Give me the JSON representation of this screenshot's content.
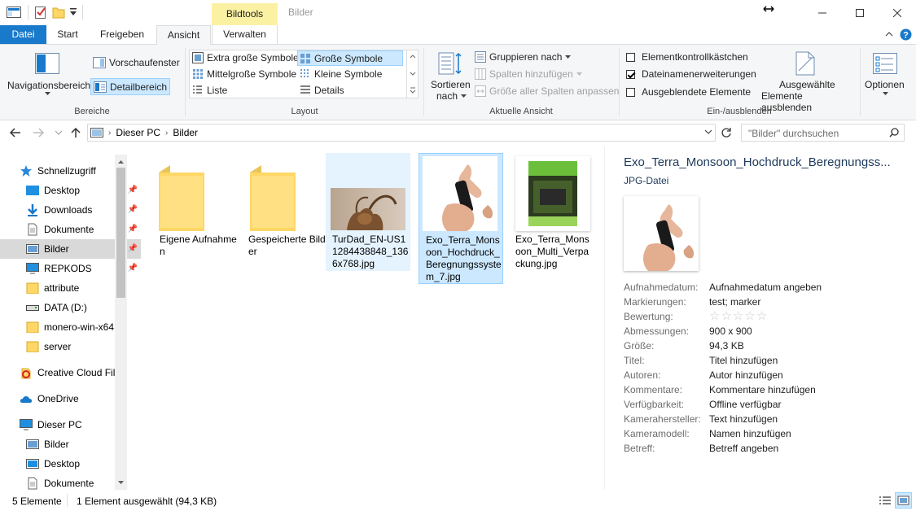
{
  "window": {
    "title": "Bilder",
    "context_tab": "Bildtools"
  },
  "ribbon_tabs": [
    "Datei",
    "Start",
    "Freigeben",
    "Ansicht",
    "Verwalten"
  ],
  "ribbon": {
    "panes": {
      "group_label": "Bereiche",
      "navigation_pane": "Navigationsbereich",
      "preview_pane": "Vorschaufenster",
      "details_pane": "Detailbereich"
    },
    "layout": {
      "group_label": "Layout",
      "options": [
        "Extra große Symbole",
        "Große Symbole",
        "Mittelgroße Symbole",
        "Kleine Symbole",
        "Liste",
        "Details"
      ],
      "selected": "Große Symbole"
    },
    "current_view": {
      "group_label": "Aktuelle Ansicht",
      "sort_by_line1": "Sortieren",
      "sort_by_line2": "nach",
      "group_by": "Gruppieren nach",
      "add_columns": "Spalten hinzufügen",
      "size_columns": "Größe aller Spalten anpassen"
    },
    "show_hide": {
      "group_label": "Ein-/ausblenden",
      "item_checkboxes": "Elementkontrollkästchen",
      "item_checkboxes_checked": false,
      "file_extensions": "Dateinamenerweiterungen",
      "file_extensions_checked": true,
      "hidden_items": "Ausgeblendete Elemente",
      "hidden_items_checked": false,
      "hide_selected_line1": "Ausgewählte",
      "hide_selected_line2": "Elemente ausblenden"
    },
    "options": "Optionen"
  },
  "address": {
    "path": [
      "Dieser PC",
      "Bilder"
    ],
    "search_placeholder": "\"Bilder\" durchsuchen"
  },
  "nav": {
    "items": [
      {
        "label": "Schnellzugriff",
        "icon": "star-icon",
        "pinned": false,
        "level": 0
      },
      {
        "label": "Desktop",
        "icon": "desktop-icon",
        "pinned": true,
        "level": 1
      },
      {
        "label": "Downloads",
        "icon": "download-icon",
        "pinned": true,
        "level": 1
      },
      {
        "label": "Dokumente",
        "icon": "document-icon",
        "pinned": true,
        "level": 1
      },
      {
        "label": "Bilder",
        "icon": "pictures-icon",
        "pinned": true,
        "level": 1,
        "selected": true
      },
      {
        "label": "REPKODS",
        "icon": "monitor-icon",
        "pinned": true,
        "level": 1
      },
      {
        "label": "attribute",
        "icon": "folder-icon",
        "pinned": false,
        "level": 1
      },
      {
        "label": "DATA (D:)",
        "icon": "drive-icon",
        "pinned": false,
        "level": 1
      },
      {
        "label": "monero-win-x64",
        "icon": "folder-icon",
        "pinned": false,
        "level": 1
      },
      {
        "label": "server",
        "icon": "folder-icon",
        "pinned": false,
        "level": 1
      },
      {
        "label": "Creative Cloud Fil",
        "icon": "creative-cloud-icon",
        "pinned": false,
        "level": 0
      },
      {
        "label": "OneDrive",
        "icon": "onedrive-icon",
        "pinned": false,
        "level": 0
      },
      {
        "label": "Dieser PC",
        "icon": "pc-icon",
        "pinned": false,
        "level": 0
      },
      {
        "label": "Bilder",
        "icon": "pictures-icon",
        "pinned": false,
        "level": 1
      },
      {
        "label": "Desktop",
        "icon": "desktop-icon",
        "pinned": false,
        "level": 1
      },
      {
        "label": "Dokumente",
        "icon": "document-icon",
        "pinned": false,
        "level": 1
      }
    ]
  },
  "files": [
    {
      "name": "Eigene Aufnahmen",
      "type": "folder",
      "state": "none"
    },
    {
      "name": "Gespeicherte Bilder",
      "type": "folder",
      "state": "none"
    },
    {
      "name": "TurDad_EN-US11284438848_1366x768.jpg",
      "type": "ibex-image",
      "state": "hover"
    },
    {
      "name": "Exo_Terra_Monsoon_Hochdruck_Beregnungssystem_7.jpg",
      "type": "nozzle-image",
      "state": "selected"
    },
    {
      "name": "Exo_Terra_Monsoon_Multi_Verpackung.jpg",
      "type": "box-image",
      "state": "none"
    }
  ],
  "details": {
    "title": "Exo_Terra_Monsoon_Hochdruck_Beregnungss...",
    "file_type": "JPG-Datei",
    "rating_stars": 0,
    "props": [
      {
        "key": "Aufnahmedatum:",
        "value": "Aufnahmedatum angeben"
      },
      {
        "key": "Markierungen:",
        "value": "test; marker"
      },
      {
        "key": "Bewertung:",
        "value": ""
      },
      {
        "key": "Abmessungen:",
        "value": "900 x 900"
      },
      {
        "key": "Größe:",
        "value": "94,3 KB"
      },
      {
        "key": "Titel:",
        "value": "Titel hinzufügen"
      },
      {
        "key": "Autoren:",
        "value": "Autor hinzufügen"
      },
      {
        "key": "Kommentare:",
        "value": "Kommentare hinzufügen"
      },
      {
        "key": "Verfügbarkeit:",
        "value": "Offline verfügbar"
      },
      {
        "key": "Kamerahersteller:",
        "value": "Text hinzufügen"
      },
      {
        "key": "Kameramodell:",
        "value": "Namen hinzufügen"
      },
      {
        "key": "Betreff:",
        "value": "Betreff angeben"
      }
    ]
  },
  "status": {
    "count": "5 Elemente",
    "selection": "1 Element ausgewählt (94,3 KB)"
  },
  "colors": {
    "accent": "#1979ca",
    "selected_bg": "#cce8ff",
    "hover_bg": "#e5f3ff",
    "folder": "#ffd766"
  }
}
